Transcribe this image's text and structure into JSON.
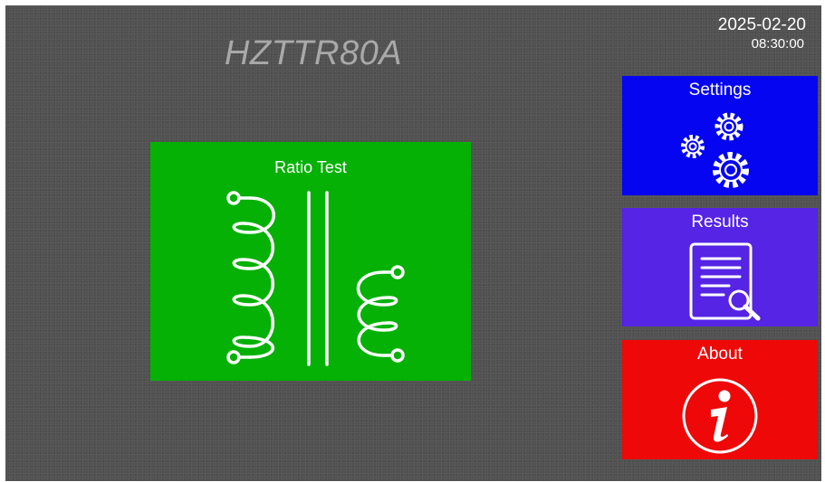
{
  "header": {
    "app_title": "HZTTR80A",
    "date": "2025-02-20",
    "time": "08:30:00"
  },
  "main": {
    "ratio_test": {
      "label": "Ratio Test",
      "icon": "transformer-icon",
      "color": "#05b105"
    }
  },
  "sidebar": {
    "settings": {
      "label": "Settings",
      "icon": "gears-icon",
      "color": "#0505f2"
    },
    "results": {
      "label": "Results",
      "icon": "document-search-icon",
      "color": "#5524e4"
    },
    "about": {
      "label": "About",
      "icon": "info-icon",
      "color": "#ef0808"
    }
  },
  "colors": {
    "background": "#515151",
    "title_text": "#a9a9a9",
    "foreground": "#ffffff"
  }
}
